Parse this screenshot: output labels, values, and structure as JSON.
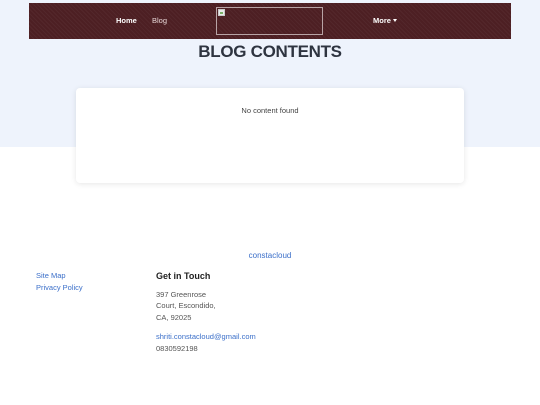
{
  "nav": {
    "home": "Home",
    "blog": "Blog",
    "more": "More",
    "logo_icon": "broken-image-icon",
    "more_icon": "caret-down-icon"
  },
  "page": {
    "title": "BLOG CONTENTS",
    "empty_message": "No content found"
  },
  "footer": {
    "brand": "constacloud",
    "links": {
      "sitemap": "Site Map",
      "privacy": "Privacy Policy"
    },
    "contact": {
      "heading": "Get in Touch",
      "address_lines": [
        "397 Greenrose",
        "Court, Escondido,",
        "CA, 92025"
      ],
      "email": "shriti.constacloud@gmail.com",
      "phone": "0830592198"
    }
  },
  "colors": {
    "navbar": "#4d1f23",
    "hero_background": "#eef3fc",
    "link": "#3b6fc9",
    "title": "#2e3440"
  }
}
